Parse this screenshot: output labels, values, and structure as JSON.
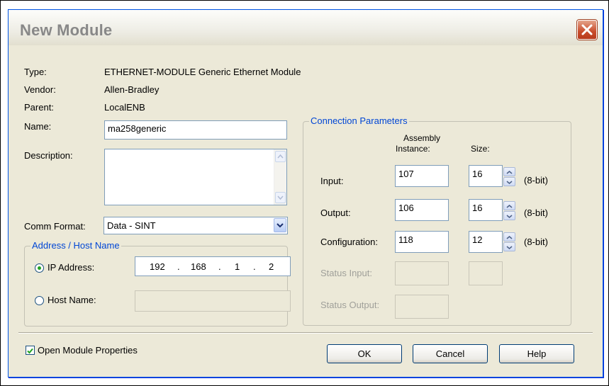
{
  "dialog": {
    "title": "New Module"
  },
  "info": {
    "type_label": "Type:",
    "type_value": "ETHERNET-MODULE Generic Ethernet Module",
    "vendor_label": "Vendor:",
    "vendor_value": "Allen-Bradley",
    "parent_label": "Parent:",
    "parent_value": "LocalENB"
  },
  "form": {
    "name_label": "Name:",
    "name_value": "ma258generic",
    "description_label": "Description:",
    "description_value": "",
    "comm_format_label": "Comm Format:",
    "comm_format_value": "Data - SINT"
  },
  "address": {
    "group_title": "Address / Host Name",
    "ip_label": "IP Address:",
    "ip_octets": [
      "192",
      "168",
      "1",
      "2"
    ],
    "ip_selected": true,
    "host_label": "Host Name:",
    "host_value": ""
  },
  "connection": {
    "group_title": "Connection Parameters",
    "assembly_header_line1": "Assembly",
    "assembly_header_line2": "Instance:",
    "size_header": "Size:",
    "rows": [
      {
        "label": "Input:",
        "instance": "107",
        "size": "16",
        "unit": "(8-bit)"
      },
      {
        "label": "Output:",
        "instance": "106",
        "size": "16",
        "unit": "(8-bit)"
      },
      {
        "label": "Configuration:",
        "instance": "118",
        "size": "12",
        "unit": "(8-bit)"
      }
    ],
    "status_input_label": "Status Input:",
    "status_output_label": "Status Output:"
  },
  "footer": {
    "open_props_label": "Open Module Properties",
    "open_props_checked": true,
    "ok_label": "OK",
    "cancel_label": "Cancel",
    "help_label": "Help"
  },
  "colors": {
    "accent": "#0046d5",
    "close_button": "#c84c2c",
    "check_mark": "#21a121"
  }
}
